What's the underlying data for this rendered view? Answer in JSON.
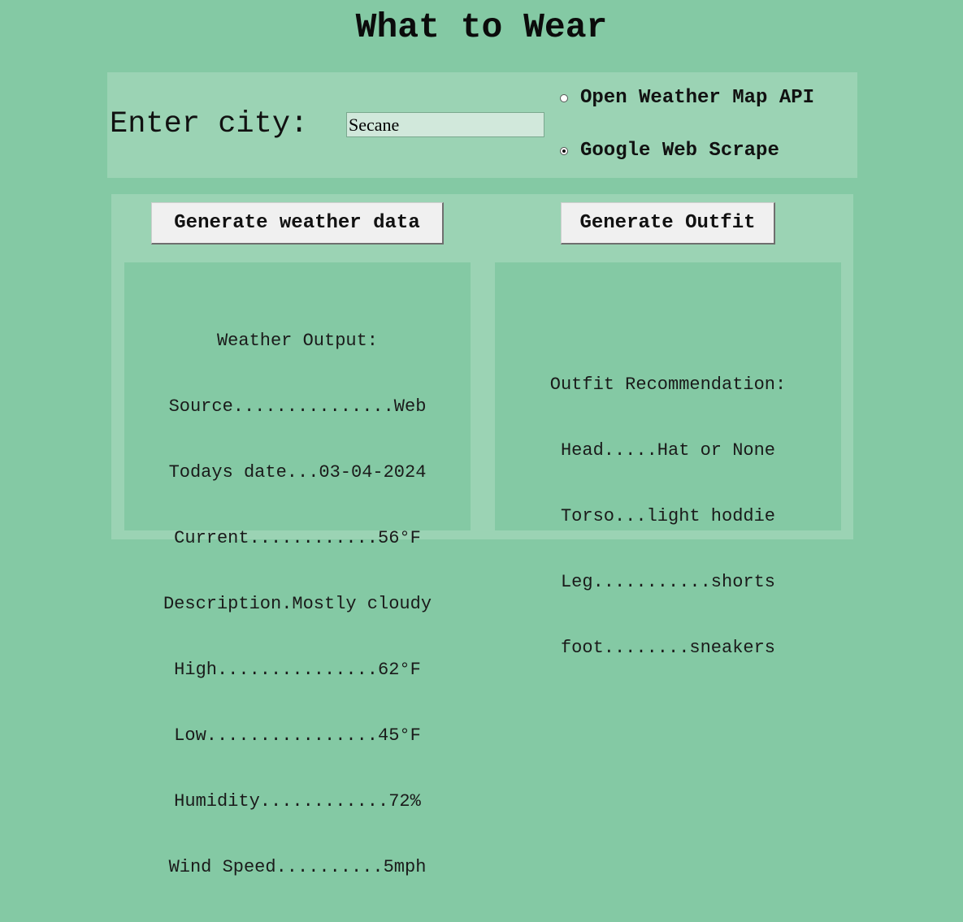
{
  "app": {
    "title": "What to Wear"
  },
  "city": {
    "label": "Enter city:",
    "value": "Secane"
  },
  "source_options": [
    {
      "label": "Open Weather Map API",
      "selected": false
    },
    {
      "label": "Google Web Scrape",
      "selected": true
    }
  ],
  "buttons": {
    "generate_weather": "Generate weather data",
    "generate_outfit": "Generate Outfit"
  },
  "weather_output": {
    "lines": [
      "Weather Output:",
      "Source...............Web",
      "Todays date...03-04-2024",
      "Current............56°F",
      "Description.Mostly cloudy",
      "High...............62°F",
      "Low................45°F",
      "Humidity............72%",
      "Wind Speed..........5mph"
    ]
  },
  "outfit_output": {
    "lines": [
      "Outfit Recommendation:",
      "Head.....Hat or None",
      "Torso...light hoddie",
      "Leg...........shorts",
      "foot........sneakers"
    ]
  },
  "colors": {
    "background": "#84c9a4",
    "panel": "#9bd3b4",
    "input_bg": "#d1e8db",
    "button_bg": "#f0f0f0"
  }
}
